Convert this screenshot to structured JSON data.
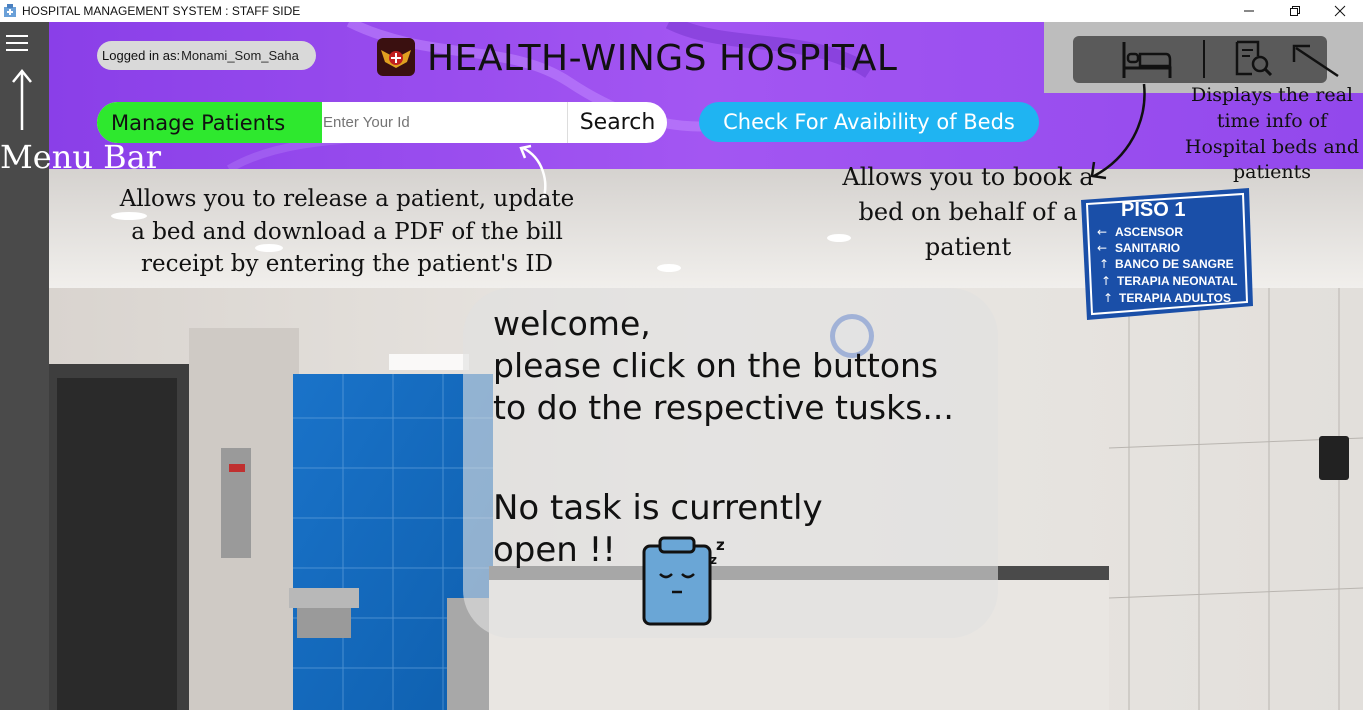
{
  "window": {
    "title": "HOSPITAL MANAGEMENT SYSTEM : STAFF SIDE",
    "minimize_glyph": "—",
    "maximize_glyph": "❐",
    "close_glyph": "✕"
  },
  "sidebar": {
    "menu_icon": "hamburger-menu-icon"
  },
  "header": {
    "logged_in_label": "Logged in as:",
    "logged_in_user": "Monami_Som_Saha",
    "hospital_name": "HEALTH-WINGS HOSPITAL",
    "manage_patients_label": "Manage Patients",
    "id_placeholder": "Enter Your Id",
    "search_label": "Search",
    "check_beds_label": "Check For Avaibility of Beds",
    "icons": [
      "bed-icon",
      "document-search-icon"
    ]
  },
  "annotations": {
    "menu_bar": "Menu Bar",
    "manage": "Allows you to release a patient, update a bed and download a PDF of the bill receipt by entering the patient's ID",
    "book": "Allows you to book a bed on behalf of a patient",
    "realtime": "Displays the real time info of Hospital beds and patients"
  },
  "welcome": {
    "message": "welcome,\nplease click on the buttons\nto do the respective tusks...",
    "status": "No task is currently open !!"
  },
  "sign": {
    "title": "PISO 1",
    "items": [
      "ASCENSOR",
      "SANITARIO",
      "BANCO DE SANGRE",
      "TERAPIA NEONATAL",
      "TERAPIA ADULTOS"
    ]
  },
  "colors": {
    "header_purple": "#9b4ff0",
    "manage_green": "#2ee82e",
    "beds_blue": "#1fb4f2",
    "sidebar": "#4a4a4a"
  }
}
